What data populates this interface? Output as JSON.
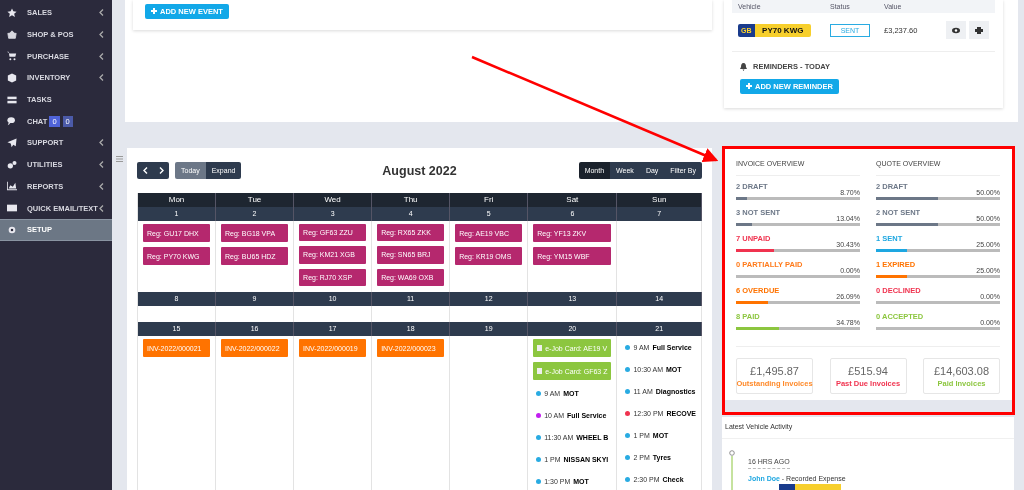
{
  "sidebar": {
    "items": [
      {
        "label": "SALES",
        "expandable": true,
        "selected": false
      },
      {
        "label": "SHOP & POS",
        "expandable": true,
        "selected": false
      },
      {
        "label": "PURCHASE",
        "expandable": true,
        "selected": false
      },
      {
        "label": "INVENTORY",
        "expandable": true,
        "selected": false
      },
      {
        "label": "TASKS",
        "expandable": false,
        "selected": false
      },
      {
        "label": "CHAT",
        "expandable": false,
        "selected": false,
        "badges": [
          "0",
          "0"
        ]
      },
      {
        "label": "SUPPORT",
        "expandable": true,
        "selected": false
      },
      {
        "label": "UTILITIES",
        "expandable": true,
        "selected": false
      },
      {
        "label": "REPORTS",
        "expandable": true,
        "selected": false
      },
      {
        "label": "QUICK EMAIL/TEXT",
        "expandable": true,
        "selected": false
      },
      {
        "label": "SETUP",
        "expandable": false,
        "selected": true
      }
    ]
  },
  "events_panel": {
    "add_button": "ADD NEW EVENT"
  },
  "vehicle_table": {
    "columns": [
      "Vehicle",
      "Status",
      "Value"
    ],
    "rows": [
      {
        "plate_country": "GB",
        "plate": "PY70 KWG",
        "status": "SENT",
        "value": "£3,237.60"
      }
    ]
  },
  "reminders": {
    "title": "REMINDERS - TODAY",
    "add_button": "ADD NEW REMINDER"
  },
  "calendar": {
    "title": "August 2022",
    "nav": [
      {
        "label": "Today",
        "selected": true
      },
      {
        "label": "Expand",
        "selected": false
      }
    ],
    "views": [
      {
        "label": "Month",
        "selected": true
      },
      {
        "label": "Week",
        "selected": false
      },
      {
        "label": "Day",
        "selected": false
      },
      {
        "label": "Filter By",
        "selected": false
      }
    ],
    "weekdays": [
      "Mon",
      "Tue",
      "Wed",
      "Thu",
      "Fri",
      "Sat",
      "Sun"
    ],
    "weeks": [
      {
        "days": [
          {
            "date": "1",
            "events": [
              {
                "kind": "reg",
                "text": "Reg: GU17 DHX"
              },
              {
                "kind": "reg",
                "text": "Reg: PY70 KWG"
              }
            ]
          },
          {
            "date": "2",
            "events": [
              {
                "kind": "reg",
                "text": "Reg: BG18 VPA"
              },
              {
                "kind": "reg",
                "text": "Reg: BU65 HDZ"
              }
            ]
          },
          {
            "date": "3",
            "events": [
              {
                "kind": "reg",
                "text": "Reg: GF63 ZZU"
              },
              {
                "kind": "reg",
                "text": "Reg: KM21 XGB"
              },
              {
                "kind": "reg",
                "text": "Reg: RJ70 XSP"
              }
            ]
          },
          {
            "date": "4",
            "events": [
              {
                "kind": "reg",
                "text": "Reg: RX65 ZKK"
              },
              {
                "kind": "reg",
                "text": "Reg: SN65 BRJ"
              },
              {
                "kind": "reg",
                "text": "Reg: WA69 OXB"
              }
            ]
          },
          {
            "date": "5",
            "events": [
              {
                "kind": "reg",
                "text": "Reg: AE19 VBC"
              },
              {
                "kind": "reg",
                "text": "Reg: KR19 OMS"
              }
            ]
          },
          {
            "date": "6",
            "events": [
              {
                "kind": "reg",
                "text": "Reg: YF13 ZKV"
              },
              {
                "kind": "reg",
                "text": "Reg: YM15 WBF"
              }
            ]
          },
          {
            "date": "7"
          }
        ]
      },
      {
        "days": [
          {
            "date": "8"
          },
          {
            "date": "9"
          },
          {
            "date": "10"
          },
          {
            "date": "11"
          },
          {
            "date": "12"
          },
          {
            "date": "13"
          },
          {
            "date": "14"
          }
        ]
      },
      {
        "days": [
          {
            "date": "15",
            "events": [
              {
                "kind": "invoice",
                "text": "INV-2022/000021"
              }
            ]
          },
          {
            "date": "16",
            "events": [
              {
                "kind": "invoice",
                "text": "INV-2022/000022"
              }
            ]
          },
          {
            "date": "17",
            "events": [
              {
                "kind": "invoice",
                "text": "INV-2022/000019"
              }
            ]
          },
          {
            "date": "18",
            "events": [
              {
                "kind": "invoice",
                "text": "INV-2022/000023"
              }
            ]
          },
          {
            "date": "19"
          },
          {
            "date": "20",
            "events": [
              {
                "kind": "job_card",
                "text": "e-Job Card: AE19 V"
              },
              {
                "kind": "job_card",
                "text": "e-Job Card: GF63 Z"
              },
              {
                "kind": "appointment",
                "time": "9 AM",
                "title": "MOT",
                "color": "#29abe2"
              },
              {
                "kind": "appointment",
                "time": "10 AM",
                "title": "Full Service",
                "color": "#c21ef0"
              },
              {
                "kind": "appointment",
                "time": "11:30 AM",
                "title": "WHEEL B",
                "color": "#29abe2"
              },
              {
                "kind": "appointment",
                "time": "1 PM",
                "title": "NISSAN SKYI",
                "color": "#29abe2"
              },
              {
                "kind": "appointment",
                "time": "1:30 PM",
                "title": "MOT",
                "color": "#29abe2"
              }
            ]
          },
          {
            "date": "21",
            "events": [
              {
                "kind": "appointment",
                "time": "9 AM",
                "title": "Full Service",
                "color": "#29abe2"
              },
              {
                "kind": "appointment",
                "time": "10:30 AM",
                "title": "MOT",
                "color": "#29abe2"
              },
              {
                "kind": "appointment",
                "time": "11 AM",
                "title": "Diagnostics",
                "color": "#29abe2"
              },
              {
                "kind": "appointment",
                "time": "12:30 PM",
                "title": "RECOVE",
                "color": "#f0334f"
              },
              {
                "kind": "appointment",
                "time": "1 PM",
                "title": "MOT",
                "color": "#29abe2"
              },
              {
                "kind": "appointment",
                "time": "2 PM",
                "title": "Tyres",
                "color": "#29abe2"
              },
              {
                "kind": "appointment",
                "time": "2:30 PM",
                "title": "Check",
                "color": "#29abe2"
              }
            ]
          }
        ]
      }
    ]
  },
  "overview": {
    "columns": [
      {
        "title": "INVOICE OVERVIEW",
        "rows": [
          {
            "count": "2",
            "label": "DRAFT",
            "percent": "8.70%",
            "level": 0.087,
            "color": "#6c7787"
          },
          {
            "count": "3",
            "label": "NOT SENT",
            "percent": "13.04%",
            "level": 0.1304,
            "color": "#6c7787"
          },
          {
            "count": "7",
            "label": "UNPAID",
            "percent": "30.43%",
            "level": 0.3043,
            "color": "#f0334f"
          },
          {
            "count": "0",
            "label": "PARTIALLY PAID",
            "percent": "0.00%",
            "level": 0,
            "color": "#ff7a1a"
          },
          {
            "count": "6",
            "label": "OVERDUE",
            "percent": "26.09%",
            "level": 0.2609,
            "color": "#ff7300"
          },
          {
            "count": "8",
            "label": "PAID",
            "percent": "34.78%",
            "level": 0.3478,
            "color": "#8cc63f"
          }
        ]
      },
      {
        "title": "QUOTE OVERVIEW",
        "rows": [
          {
            "count": "2",
            "label": "DRAFT",
            "percent": "50.00%",
            "level": 0.5,
            "color": "#6c7787"
          },
          {
            "count": "2",
            "label": "NOT SENT",
            "percent": "50.00%",
            "level": 0.5,
            "color": "#6c7787"
          },
          {
            "count": "1",
            "label": "SENT",
            "percent": "25.00%",
            "level": 0.25,
            "color": "#1ea7e1"
          },
          {
            "count": "1",
            "label": "EXPIRED",
            "percent": "25.00%",
            "level": 0.25,
            "color": "#ff7300"
          },
          {
            "count": "0",
            "label": "DECLINED",
            "percent": "0.00%",
            "level": 0,
            "color": "#f0334f"
          },
          {
            "count": "0",
            "label": "ACCEPTED",
            "percent": "0.00%",
            "level": 0,
            "color": "#8cc63f"
          }
        ]
      }
    ],
    "totals": [
      {
        "amount": "£1,495.87",
        "label": "Outstanding Invoices",
        "color": "#ff8a2a"
      },
      {
        "amount": "£515.94",
        "label": "Past Due Invoices",
        "color": "#f0334f"
      },
      {
        "amount": "£14,603.08",
        "label": "Paid Invoices",
        "color": "#8cc63f"
      }
    ]
  },
  "activity": {
    "title": "Latest Vehicle Activity",
    "entries": [
      {
        "time": "16 HRS AGO",
        "user": "John Doe",
        "action": "- Recorded Expense"
      }
    ]
  }
}
